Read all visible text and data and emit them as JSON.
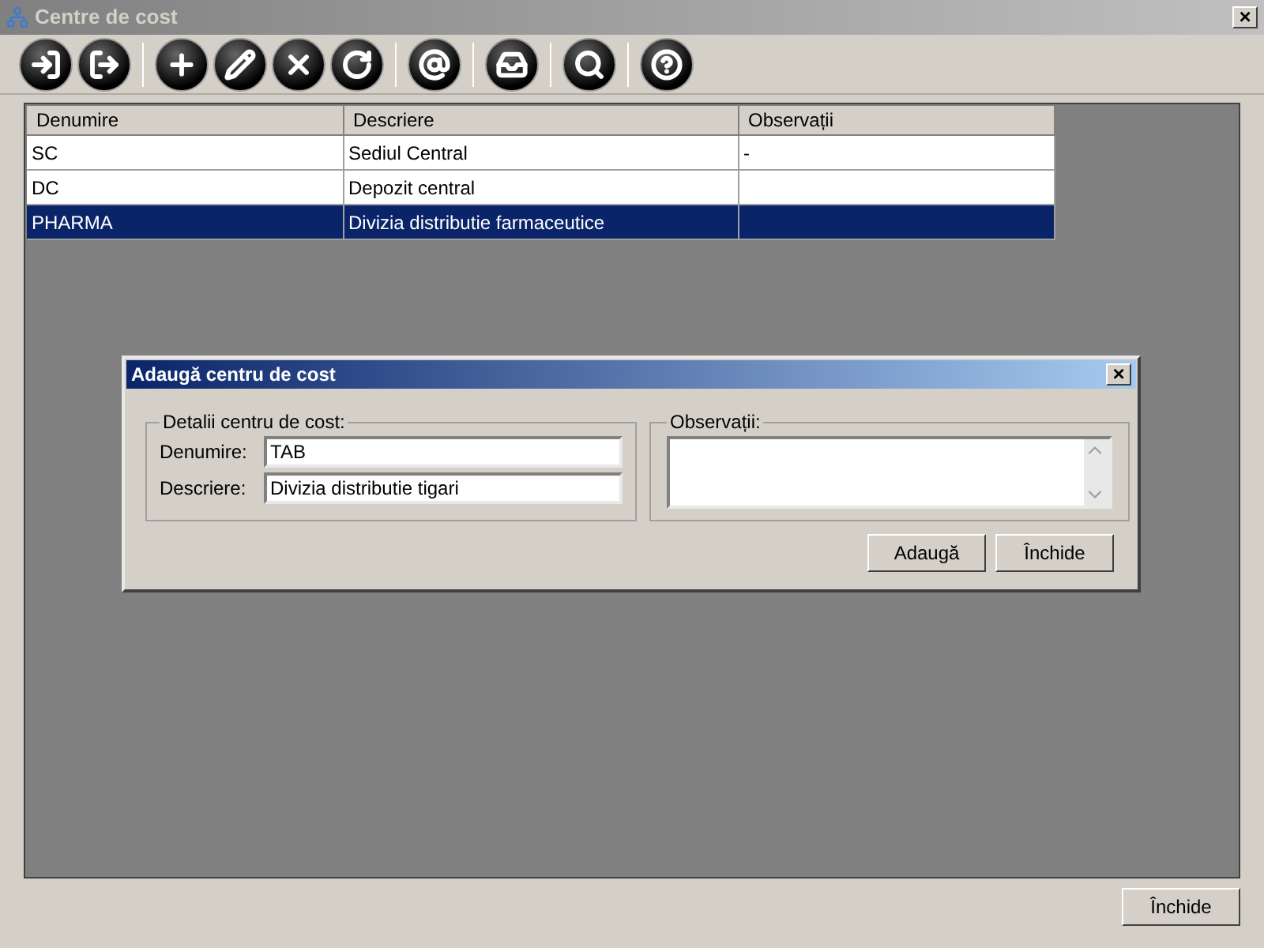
{
  "window": {
    "title": "Centre de cost",
    "close": "×"
  },
  "table": {
    "columns": [
      "Denumire",
      "Descriere",
      "Observații"
    ],
    "rows": [
      {
        "cells": [
          "SC",
          "Sediul Central",
          "-"
        ],
        "selected": false
      },
      {
        "cells": [
          "DC",
          "Depozit central",
          ""
        ],
        "selected": false
      },
      {
        "cells": [
          "PHARMA",
          "Divizia distributie farmaceutice",
          ""
        ],
        "selected": true
      }
    ]
  },
  "dialog": {
    "title": "Adaugă centru de cost",
    "close": "×",
    "details_group": {
      "title": "Detalii centru de cost:",
      "fields": [
        {
          "label": "Denumire:",
          "value": "TAB"
        },
        {
          "label": "Descriere:",
          "value": "Divizia distributie tigari"
        }
      ]
    },
    "notes_group": {
      "title": "Observații:"
    },
    "buttons": [
      "Adaugă",
      "Închide"
    ]
  },
  "footer_button": "Închide"
}
